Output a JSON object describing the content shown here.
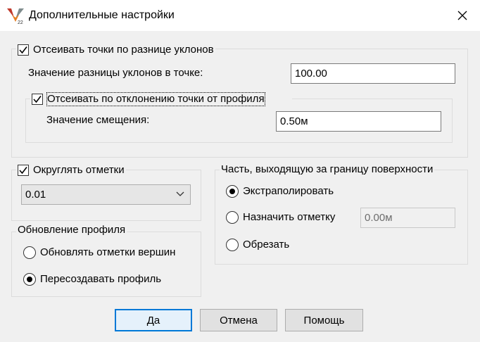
{
  "window": {
    "title": "Дополнительные настройки",
    "app_icon_badge": "22"
  },
  "filter_slope": {
    "checkbox_label": "Отсеивать точки по разнице уклонов",
    "checked": true,
    "value_label": "Значение разницы уклонов в точке:",
    "value": "100.00",
    "deviation": {
      "checkbox_label": "Отсеивать по отклонению точки от профиля",
      "checked": true,
      "offset_label": "Значение смещения:",
      "offset_value": "0.50м"
    }
  },
  "round": {
    "checkbox_label": "Округлять отметки",
    "checked": true,
    "selected": "0.01"
  },
  "profile_update": {
    "title": "Обновление профиля",
    "options": [
      {
        "label": "Обновлять отметки вершин",
        "selected": false
      },
      {
        "label": "Пересоздавать профиль",
        "selected": true
      }
    ]
  },
  "outside_surface": {
    "title": "Часть, выходящую за границу поверхности",
    "options": [
      {
        "label": "Экстраполировать",
        "selected": true
      },
      {
        "label": "Назначить отметку",
        "selected": false
      },
      {
        "label": "Обрезать",
        "selected": false
      }
    ],
    "elevation_value": "0.00м"
  },
  "buttons": {
    "ok": "Да",
    "cancel": "Отмена",
    "help": "Помощь"
  },
  "colors": {
    "accent": "#0078d7",
    "background": "#f0f0f0"
  }
}
